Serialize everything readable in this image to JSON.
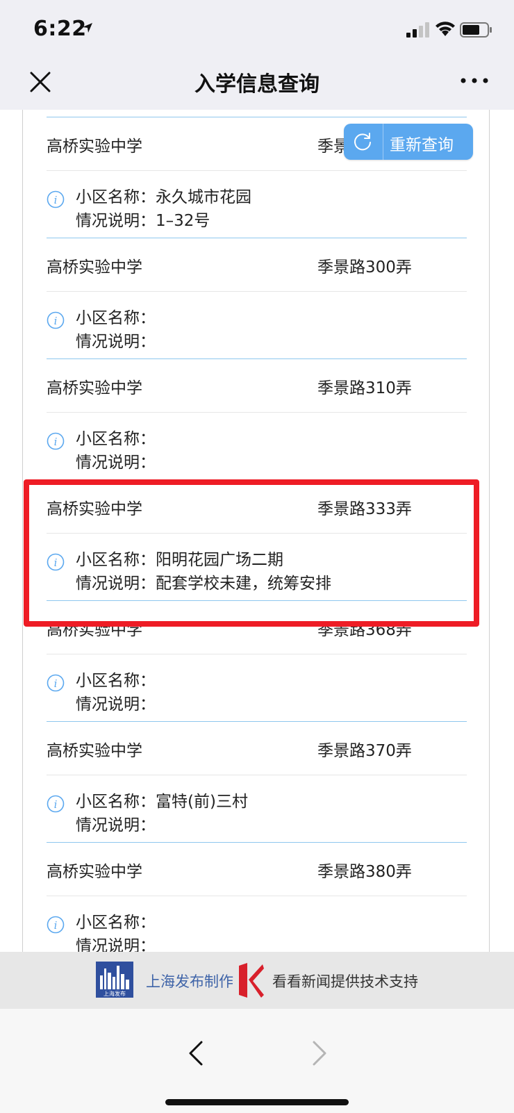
{
  "status_bar": {
    "time": "6:22"
  },
  "nav": {
    "title": "入学信息查询"
  },
  "requery_button": {
    "label": "重新查询"
  },
  "entries": [
    {
      "school": "高桥实验中学",
      "address": "季景",
      "community_label": "小区名称：",
      "community": "永久城市花园",
      "note_label": "情况说明：",
      "note": "1–32号"
    },
    {
      "school": "高桥实验中学",
      "address": "季景路300弄",
      "community_label": "小区名称：",
      "community": "",
      "note_label": "情况说明：",
      "note": ""
    },
    {
      "school": "高桥实验中学",
      "address": "季景路310弄",
      "community_label": "小区名称：",
      "community": "",
      "note_label": "情况说明：",
      "note": ""
    },
    {
      "school": "高桥实验中学",
      "address": "季景路333弄",
      "community_label": "小区名称：",
      "community": "阳明花园广场二期",
      "note_label": "情况说明：",
      "note": "配套学校未建，统筹安排"
    },
    {
      "school": "高桥实验中学",
      "address": "季景路368弄",
      "community_label": "小区名称：",
      "community": "",
      "note_label": "情况说明：",
      "note": ""
    },
    {
      "school": "高桥实验中学",
      "address": "季景路370弄",
      "community_label": "小区名称：",
      "community": "富特(前)三村",
      "note_label": "情况说明：",
      "note": ""
    },
    {
      "school": "高桥实验中学",
      "address": "季景路380弄",
      "community_label": "小区名称：",
      "community": "",
      "note_label": "情况说明：",
      "note": ""
    }
  ],
  "footer": {
    "producer": "上海发布制作",
    "support": "看看新闻提供技术支持",
    "logo_text": "上海发布"
  },
  "colors": {
    "accent": "#5ba8ef",
    "highlight": "#ee1c25",
    "divider": "#8ec7ee"
  }
}
